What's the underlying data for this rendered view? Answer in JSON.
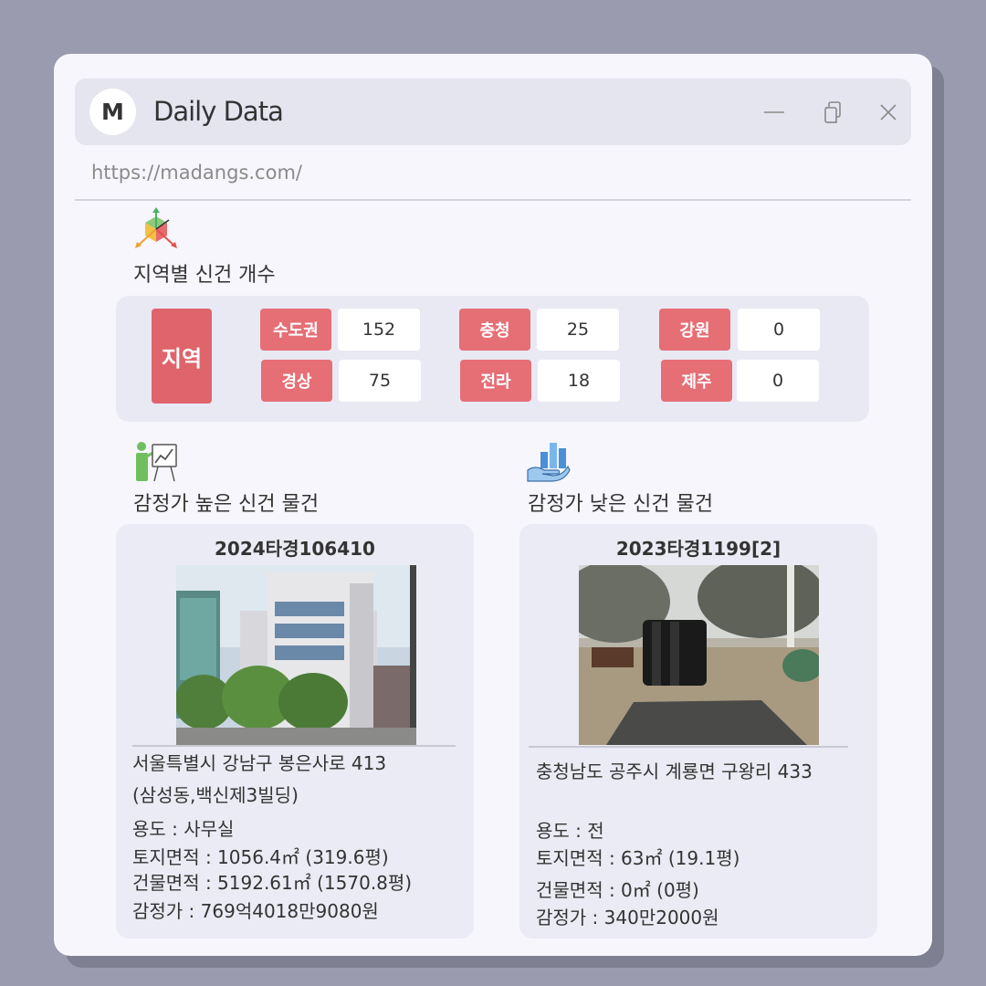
{
  "window": {
    "logo_letter": "M",
    "title": "Daily Data",
    "url": "https://madangs.com/",
    "controls": [
      "minimize-icon",
      "copy-icon",
      "close-icon"
    ]
  },
  "region_section": {
    "title": "지역별 신건 개수",
    "icon": "cube-axes-icon",
    "main_label": "지역",
    "regions": [
      {
        "label": "수도권",
        "value": "152"
      },
      {
        "label": "충청",
        "value": "25"
      },
      {
        "label": "강원",
        "value": "0"
      },
      {
        "label": "경상",
        "value": "75"
      },
      {
        "label": "전라",
        "value": "18"
      },
      {
        "label": "제주",
        "value": "0"
      }
    ]
  },
  "high_section": {
    "title": "감정가 높은 신건 물건",
    "icon": "presentation-chart-icon",
    "case_no": "2024타경106410",
    "address_line1": "서울특별시 강남구 봉은사로 413",
    "address_line2": "(삼성동,백신제3빌딩)",
    "use": "용도 : 사무실",
    "land_area": "토지면적 : 1056.4㎡ (319.6평)",
    "building_area": "건물면적 : 5192.61㎡ (1570.8평)",
    "appraisal": "감정가 : 769억4018만9080원"
  },
  "low_section": {
    "title": "감정가 낮은 신건 물건",
    "icon": "hand-bar-chart-icon",
    "case_no": "2023타경1199[2]",
    "address_line1": "충청남도 공주시 계룡면 구왕리 433",
    "use": "용도 : 전",
    "land_area": "토지면적 : 63㎡ (19.1평)",
    "building_area": "건물면적 : 0㎡ (0평)",
    "appraisal": "감정가 : 340만2000원"
  },
  "colors": {
    "background": "#9a9bae",
    "window": "#f6f6fc",
    "titlebar": "#e4e5ef",
    "region_label": "#e66e75",
    "panel": "#e9e9f4"
  }
}
